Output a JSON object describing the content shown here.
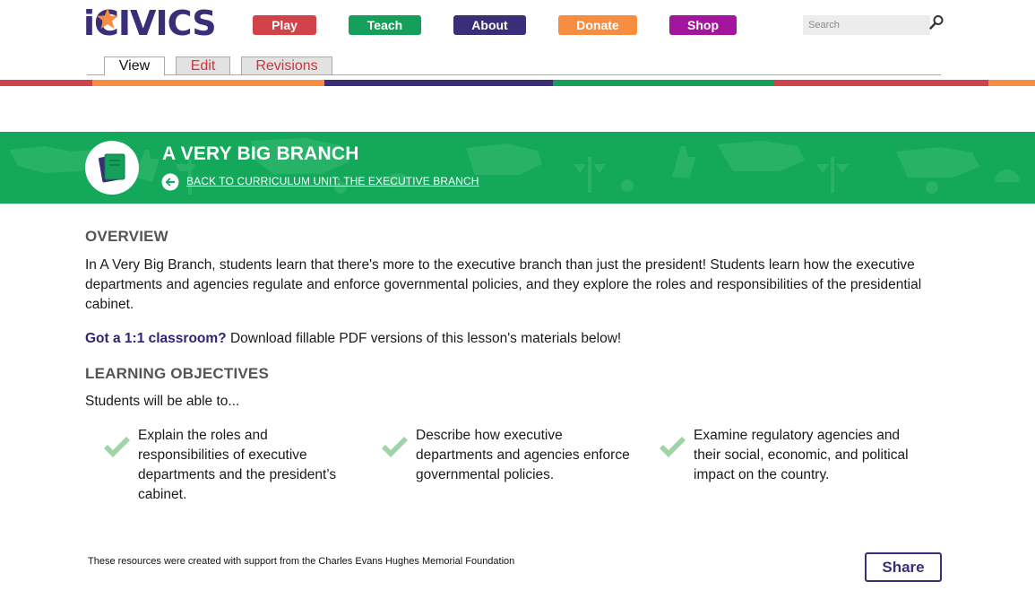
{
  "brand": {
    "logo_text": "iCIVICS",
    "colors": {
      "purple": "#3a2e78",
      "red": "#d24349",
      "green": "#14a05a",
      "orange": "#f68d40",
      "magenta": "#a3159c",
      "banner": "#14a85a",
      "check": "#9ed4a6"
    }
  },
  "nav": {
    "play": "Play",
    "teach": "Teach",
    "about": "About",
    "donate": "Donate",
    "shop": "Shop"
  },
  "search": {
    "placeholder": "Search",
    "icon": "search-icon"
  },
  "tabs": {
    "view": "View",
    "edit": "Edit",
    "revisions": "Revisions"
  },
  "banner": {
    "title": "A VERY BIG BRANCH",
    "back_link": "BACK TO CURRICULUM UNIT: THE EXECUTIVE BRANCH",
    "badge_icon": "book-icon"
  },
  "overview": {
    "heading": "OVERVIEW",
    "text": "In A Very Big Branch, students learn that there's more to the executive branch than just the president! Students learn how the executive departments and agencies regulate and enforce governmental policies, and they explore the roles and responsibilities of the presidential cabinet.",
    "oneone_strong": "Got a 1:1 classroom?",
    "oneone_rest": " Download fillable PDF versions of this lesson's materials below!"
  },
  "objectives": {
    "heading": "LEARNING OBJECTIVES",
    "intro": "Students will be able to...",
    "items": [
      "Explain the roles and responsibilities of executive departments and the president’s cabinet.",
      "Describe how executive departments and agencies enforce governmental policies.",
      "Examine regulatory agencies and their social, economic, and political impact on the country."
    ]
  },
  "footer": {
    "note": "These resources were created with support from the Charles Evans Hughes Memorial Foundation",
    "share": "Share"
  }
}
